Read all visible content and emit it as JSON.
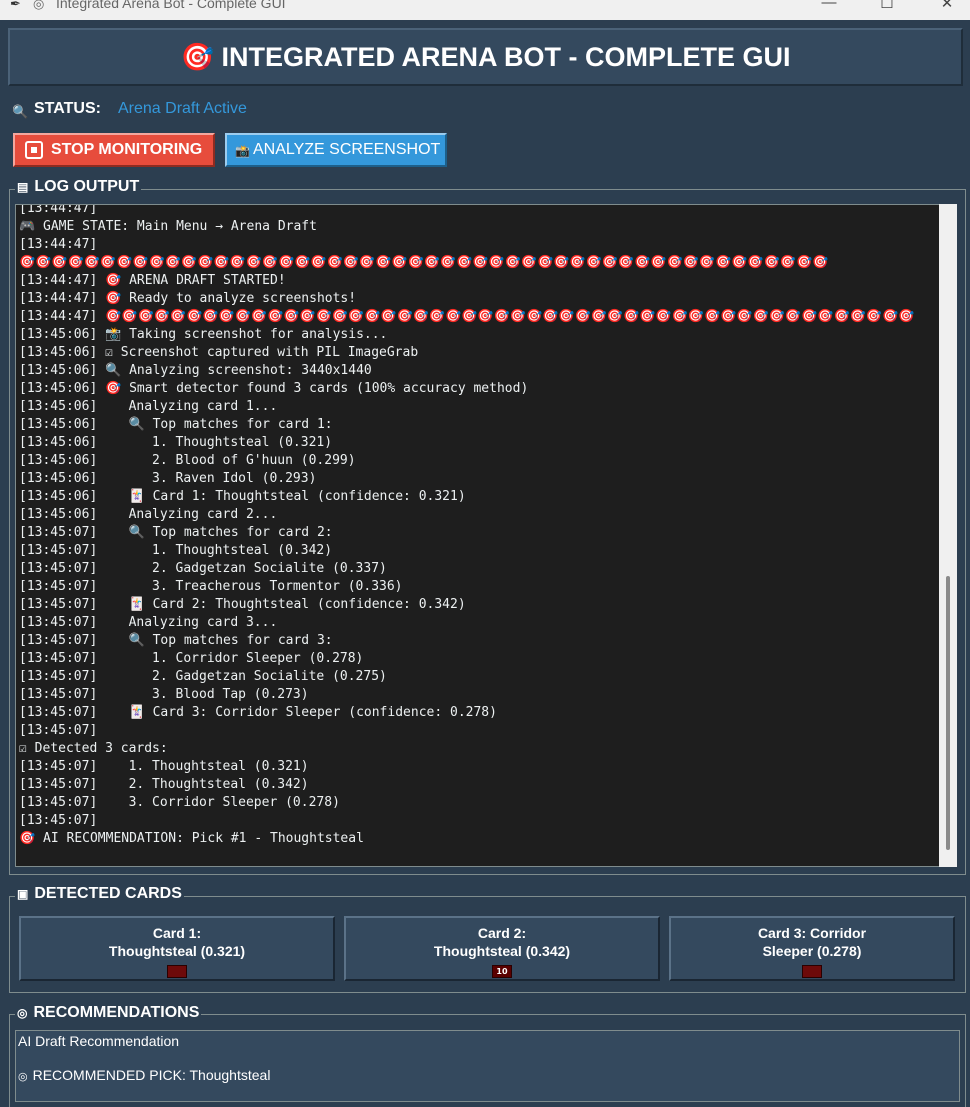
{
  "window": {
    "title": "Integrated Arena Bot - Complete GUI",
    "minimize": "—",
    "maximize": "☐",
    "close": "✕"
  },
  "header": {
    "title": "🎯 INTEGRATED ARENA BOT - COMPLETE GUI"
  },
  "status": {
    "label": "STATUS:",
    "value": "Arena Draft Active"
  },
  "buttons": {
    "stop_label": "STOP MONITORING",
    "analyze_label": "ANALYZE SCREENSHOT"
  },
  "log": {
    "title": "LOG OUTPUT",
    "lines": [
      "[13:44:47]",
      "🎮 GAME STATE: Main Menu → Arena Draft",
      "[13:44:47]",
      "🎯🎯🎯🎯🎯🎯🎯🎯🎯🎯🎯🎯🎯🎯🎯🎯🎯🎯🎯🎯🎯🎯🎯🎯🎯🎯🎯🎯🎯🎯🎯🎯🎯🎯🎯🎯🎯🎯🎯🎯🎯🎯🎯🎯🎯🎯🎯🎯🎯🎯",
      "[13:44:47] 🎯 ARENA DRAFT STARTED!",
      "[13:44:47] 🎯 Ready to analyze screenshots!",
      "[13:44:47] 🎯🎯🎯🎯🎯🎯🎯🎯🎯🎯🎯🎯🎯🎯🎯🎯🎯🎯🎯🎯🎯🎯🎯🎯🎯🎯🎯🎯🎯🎯🎯🎯🎯🎯🎯🎯🎯🎯🎯🎯🎯🎯🎯🎯🎯🎯🎯🎯🎯🎯",
      "[13:45:06] 📸 Taking screenshot for analysis...",
      "[13:45:06] ☑ Screenshot captured with PIL ImageGrab",
      "[13:45:06] 🔍 Analyzing screenshot: 3440x1440",
      "[13:45:06] 🎯 Smart detector found 3 cards (100% accuracy method)",
      "[13:45:06]    Analyzing card 1...",
      "[13:45:06]    🔍 Top matches for card 1:",
      "[13:45:06]       1. Thoughtsteal (0.321)",
      "[13:45:06]       2. Blood of G'huun (0.299)",
      "[13:45:06]       3. Raven Idol (0.293)",
      "[13:45:06]    🃏 Card 1: Thoughtsteal (confidence: 0.321)",
      "[13:45:06]    Analyzing card 2...",
      "[13:45:07]    🔍 Top matches for card 2:",
      "[13:45:07]       1. Thoughtsteal (0.342)",
      "[13:45:07]       2. Gadgetzan Socialite (0.337)",
      "[13:45:07]       3. Treacherous Tormentor (0.336)",
      "[13:45:07]    🃏 Card 2: Thoughtsteal (confidence: 0.342)",
      "[13:45:07]    Analyzing card 3...",
      "[13:45:07]    🔍 Top matches for card 3:",
      "[13:45:07]       1. Corridor Sleeper (0.278)",
      "[13:45:07]       2. Gadgetzan Socialite (0.275)",
      "[13:45:07]       3. Blood Tap (0.273)",
      "[13:45:07]    🃏 Card 3: Corridor Sleeper (confidence: 0.278)",
      "[13:45:07]",
      "☑ Detected 3 cards:",
      "[13:45:07]    1. Thoughtsteal (0.321)",
      "[13:45:07]    2. Thoughtsteal (0.342)",
      "[13:45:07]    3. Corridor Sleeper (0.278)",
      "[13:45:07]",
      "🎯 AI RECOMMENDATION: Pick #1 - Thoughtsteal"
    ]
  },
  "detected": {
    "title": "DETECTED CARDS",
    "cards": [
      {
        "text": "Card 1:\nThoughtsteal (0.321)",
        "badge": ""
      },
      {
        "text": "Card 2:\nThoughtsteal (0.342)",
        "badge": "10"
      },
      {
        "text": "Card 3: Corridor\nSleeper (0.278)",
        "badge": ""
      }
    ]
  },
  "recommendations": {
    "title": "RECOMMENDATIONS",
    "heading": "AI Draft Recommendation",
    "pick": "RECOMMENDED PICK: Thoughtsteal"
  },
  "colors": {
    "background": "#2c3e50",
    "stop_button": "#e74c3c",
    "analyze_button": "#3498db",
    "status_value": "#3498db",
    "log_background": "#1e1e1e"
  },
  "icons": {
    "header": "target-icon",
    "status": "magnifier-icon",
    "stop": "stop-icon",
    "analyze": "camera-icon",
    "log": "ledger-icon",
    "detected": "card-icon",
    "recommendations": "target-icon"
  }
}
